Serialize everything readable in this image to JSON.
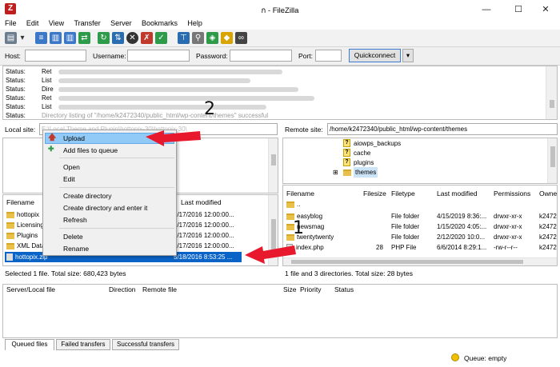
{
  "window": {
    "title": "ก - FileZilla",
    "app_icon": "Z"
  },
  "menu": [
    "File",
    "Edit",
    "View",
    "Transfer",
    "Server",
    "Bookmarks",
    "Help"
  ],
  "quickconnect": {
    "host_label": "Host:",
    "username_label": "Username:",
    "password_label": "Password:",
    "port_label": "Port:",
    "button": "Quickconnect"
  },
  "log": {
    "label": "Status:",
    "messages": [
      "Ret",
      "List",
      "Dire",
      "Ret",
      "List",
      "Directory listing of \"/home/k2472340/public_html/wp-content/themes\" successful"
    ]
  },
  "local": {
    "site_label": "Local site:",
    "path": "E:\\Local Theme and Plugin\\hottopix-30\\hottopix-30\\",
    "columns": {
      "filename": "Filename",
      "modified": "Last modified"
    },
    "files": [
      {
        "name": "hottopix",
        "modified": "5/17/2016 12:00:00..."
      },
      {
        "name": "Licensing",
        "modified": "5/17/2016 12:00:00..."
      },
      {
        "name": "Plugins",
        "modified": "5/17/2016 12:00:00..."
      },
      {
        "name": "XML Data",
        "modified": "5/17/2016 12:00:00..."
      },
      {
        "name": "hottopix.zip",
        "modified": "5/18/2016 8:53:25 ..."
      }
    ],
    "status": "Selected 1 file. Total size: 680,423 bytes"
  },
  "remote": {
    "site_label": "Remote site:",
    "path": "/home/k2472340/public_html/wp-content/themes",
    "tree": [
      "aiowps_backups",
      "cache",
      "plugins",
      "themes"
    ],
    "columns": {
      "filename": "Filename",
      "filesize": "Filesize",
      "filetype": "Filetype",
      "modified": "Last modified",
      "permissions": "Permissions",
      "owner": "Owne"
    },
    "files": [
      {
        "name": "..",
        "size": "",
        "type": "",
        "modified": "",
        "perms": "",
        "owner": ""
      },
      {
        "name": "easyblog",
        "size": "",
        "type": "File folder",
        "modified": "4/15/2019 8:36:...",
        "perms": "drwxr-xr-x",
        "owner": "k2472"
      },
      {
        "name": "newsmag",
        "size": "",
        "type": "File folder",
        "modified": "1/15/2020 4:05:...",
        "perms": "drwxr-xr-x",
        "owner": "k2472"
      },
      {
        "name": "twentytwenty",
        "size": "",
        "type": "File folder",
        "modified": "2/12/2020 10:0...",
        "perms": "drwxr-xr-x",
        "owner": "k2472"
      },
      {
        "name": "index.php",
        "size": "28",
        "type": "PHP File",
        "modified": "6/6/2014 8:29:1...",
        "perms": "-rw-r--r--",
        "owner": "k2472"
      }
    ],
    "status": "1 file and 3 directories. Total size: 28 bytes"
  },
  "context_menu": [
    "Upload",
    "Add files to queue",
    "Open",
    "Edit",
    "Create directory",
    "Create directory and enter it",
    "Refresh",
    "Delete",
    "Rename"
  ],
  "queue": {
    "columns": [
      "Server/Local file",
      "Direction",
      "Remote file",
      "Size",
      "Priority",
      "Status"
    ],
    "tabs": [
      "Queued files",
      "Failed transfers",
      "Successful transfers"
    ],
    "status": "Queue: empty"
  },
  "annotations": {
    "one": "1",
    "two": "2"
  },
  "colors": {
    "arrow": "#e8192c",
    "selection": "#cce4f7",
    "menu_highlight": "#91c9f7"
  }
}
